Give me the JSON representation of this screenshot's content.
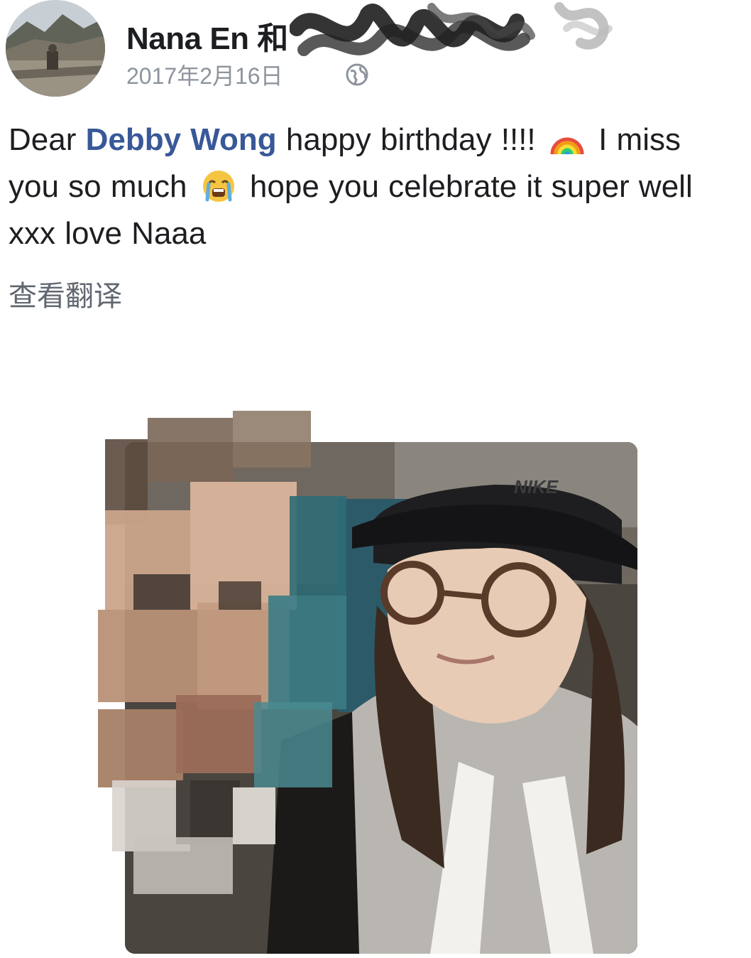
{
  "post": {
    "author": {
      "name": "Nana En 和",
      "avatar": "profile-photo"
    },
    "date": "2017年2月16日",
    "privacy_icon": "globe-icon",
    "text": {
      "part1": "Dear ",
      "mention": "Debby Wong",
      "part2": " happy birthday !!!! ",
      "emoji1": "rainbow-emoji",
      "part3": " I miss you so much ",
      "emoji2": "crying-face-emoji",
      "part4": " hope you celebrate it super well xxx love Naaa"
    },
    "translate_link": "查看翻译",
    "photo": {
      "cap_logo": "NIKE"
    }
  },
  "colors": {
    "mention": "#385898",
    "secondary_text": "#8d949e",
    "translate_text": "#606770"
  }
}
